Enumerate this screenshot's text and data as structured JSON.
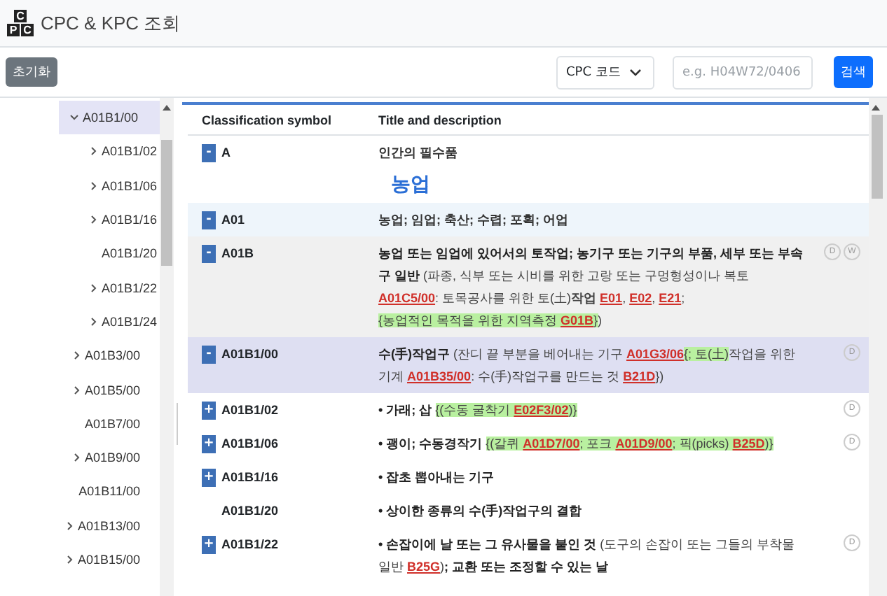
{
  "header": {
    "logo_letters": [
      "C",
      "P",
      "C"
    ],
    "title": "CPC & KPC 조회"
  },
  "toolbar": {
    "reset_button": "초기화",
    "code_select": "CPC 코드",
    "search": {
      "placeholder": "e.g. H04W72/0406"
    },
    "search_button": "검색"
  },
  "tree": [
    {
      "label": "A01B1/00",
      "expanded": true,
      "selected": true,
      "children": [
        {
          "label": "A01B1/02",
          "expandable": true,
          "selected": false
        },
        {
          "label": "A01B1/06",
          "expandable": true,
          "selected": false
        },
        {
          "label": "A01B1/16",
          "expandable": true,
          "selected": false
        },
        {
          "label": "A01B1/20",
          "expandable": false,
          "selected": false
        },
        {
          "label": "A01B1/22",
          "expandable": true,
          "selected": false
        },
        {
          "label": "A01B1/24",
          "expandable": true,
          "selected": false
        }
      ]
    },
    {
      "label": "A01B3/00",
      "expandable": true,
      "selected": false
    },
    {
      "label": "A01B5/00",
      "expandable": true,
      "selected": false
    },
    {
      "label": "A01B7/00",
      "expandable": false,
      "selected": false
    },
    {
      "label": "A01B9/00",
      "expandable": true,
      "selected": false
    },
    {
      "label": "A01B11/00",
      "expandable": false,
      "selected": false
    },
    {
      "label": "A01B13/00",
      "expandable": true,
      "selected": false
    },
    {
      "label": "A01B15/00",
      "expandable": true,
      "selected": false
    }
  ],
  "table": {
    "columns": [
      "Classification symbol",
      "Title and description"
    ],
    "rows": [
      {
        "kind": "entry",
        "toggle": "-",
        "symbol": "A",
        "hovered": false,
        "selected": false,
        "shaded": false,
        "segments": [
          {
            "kind": "plain-title",
            "text": "인간의 필수품"
          }
        ],
        "badges": []
      },
      {
        "kind": "heading",
        "text": "농업"
      },
      {
        "kind": "entry",
        "toggle": "-",
        "symbol": "A01",
        "hovered": true,
        "selected": false,
        "shaded": false,
        "segments": [
          {
            "kind": "plain-title",
            "text": "농업; 임업; 축산; 수렵; 포획; 어업"
          }
        ],
        "badges": []
      },
      {
        "kind": "entry",
        "toggle": "-",
        "symbol": "A01B",
        "hovered": false,
        "selected": false,
        "shaded": true,
        "segments": [
          {
            "kind": "title",
            "text": "농업 또는 임업에 있어서의 토작업; 농기구 또는 기구의 부품, 세부 또는 부속구 일반"
          },
          {
            "kind": "text",
            "text": " (파종, 식부 또는 시비를 위한 고랑 또는 구멍형성이나 복토 "
          },
          {
            "kind": "ref",
            "text": "A01C5/00"
          },
          {
            "kind": "text",
            "text": ": 토목공사를 위한 토(土)**작업** "
          },
          {
            "kind": "ref",
            "text": "E01"
          },
          {
            "kind": "text",
            "text": ", "
          },
          {
            "kind": "ref",
            "text": "E02"
          },
          {
            "kind": "text",
            "text": ", "
          },
          {
            "kind": "ref",
            "text": "E21"
          },
          {
            "kind": "text",
            "text": "; "
          },
          {
            "kind": "note",
            "text": "{농업적인 목적을 위한 지역측정 "
          },
          {
            "kind": "note-ref",
            "text": "G01B"
          },
          {
            "kind": "note",
            "text": "}"
          },
          {
            "kind": "text",
            "text": ")"
          }
        ],
        "badges": [
          "D",
          "W"
        ]
      },
      {
        "kind": "entry",
        "toggle": "-",
        "symbol": "A01B1/00",
        "hovered": false,
        "selected": true,
        "shaded": false,
        "segments": [
          {
            "kind": "title",
            "text": "수(手)작업구"
          },
          {
            "kind": "text",
            "text": " (잔디 끝 부분을 베어내는 기구 "
          },
          {
            "kind": "ref",
            "text": "A01G3/06"
          },
          {
            "kind": "note",
            "text": "{; 토(土)"
          },
          {
            "kind": "text",
            "text": "작업을 위한 기계 "
          },
          {
            "kind": "ref",
            "text": "A01B35/00"
          },
          {
            "kind": "text",
            "text": ": 수(手)작업구를 만드는 것 "
          },
          {
            "kind": "ref",
            "text": "B21D"
          },
          {
            "kind": "text",
            "text": "})"
          }
        ],
        "badges": [
          "D"
        ]
      },
      {
        "kind": "entry",
        "toggle": "+",
        "symbol": "A01B1/02",
        "hovered": false,
        "selected": false,
        "shaded": false,
        "segments": [
          {
            "kind": "title",
            "text": "• 가래; 삽 "
          },
          {
            "kind": "note",
            "text": "{(수동 굴착기 "
          },
          {
            "kind": "note-ref",
            "text": "E02F3/02"
          },
          {
            "kind": "note",
            "text": ")}"
          }
        ],
        "badges": [
          "D"
        ]
      },
      {
        "kind": "entry",
        "toggle": "+",
        "symbol": "A01B1/06",
        "hovered": false,
        "selected": false,
        "shaded": false,
        "segments": [
          {
            "kind": "title",
            "text": "• 괭이; 수동경작기 "
          },
          {
            "kind": "note",
            "text": "{(갈퀴 "
          },
          {
            "kind": "note-ref",
            "text": "A01D7/00"
          },
          {
            "kind": "note",
            "text": "; 포크 "
          },
          {
            "kind": "note-ref",
            "text": "A01D9/00"
          },
          {
            "kind": "note",
            "text": "; 픽(picks) "
          },
          {
            "kind": "note-ref",
            "text": "B25D"
          },
          {
            "kind": "note",
            "text": ")}"
          }
        ],
        "badges": [
          "D"
        ]
      },
      {
        "kind": "entry",
        "toggle": "+",
        "symbol": "A01B1/16",
        "hovered": false,
        "selected": false,
        "shaded": false,
        "segments": [
          {
            "kind": "title",
            "text": "• 잡초 뽑아내는 기구"
          }
        ],
        "badges": []
      },
      {
        "kind": "entry",
        "symbol": "A01B1/20",
        "hovered": false,
        "selected": false,
        "shaded": false,
        "segments": [
          {
            "kind": "title",
            "text": "• 상이한 종류의 수(手)작업구의 결합"
          }
        ],
        "badges": []
      },
      {
        "kind": "entry",
        "toggle": "+",
        "symbol": "A01B1/22",
        "hovered": false,
        "selected": false,
        "shaded": false,
        "segments": [
          {
            "kind": "title",
            "text": "• 손잡이에 날 또는 그 유사물을 붙인 것"
          },
          {
            "kind": "text",
            "text": " (도구의 손잡이 또는 그들의 부착물 일반 "
          },
          {
            "kind": "ref",
            "text": "B25G"
          },
          {
            "kind": "text",
            "text": ")"
          },
          {
            "kind": "title",
            "text": "; 교환 또는 조정할 수 있는 날"
          }
        ],
        "badges": [
          "D"
        ]
      }
    ]
  }
}
